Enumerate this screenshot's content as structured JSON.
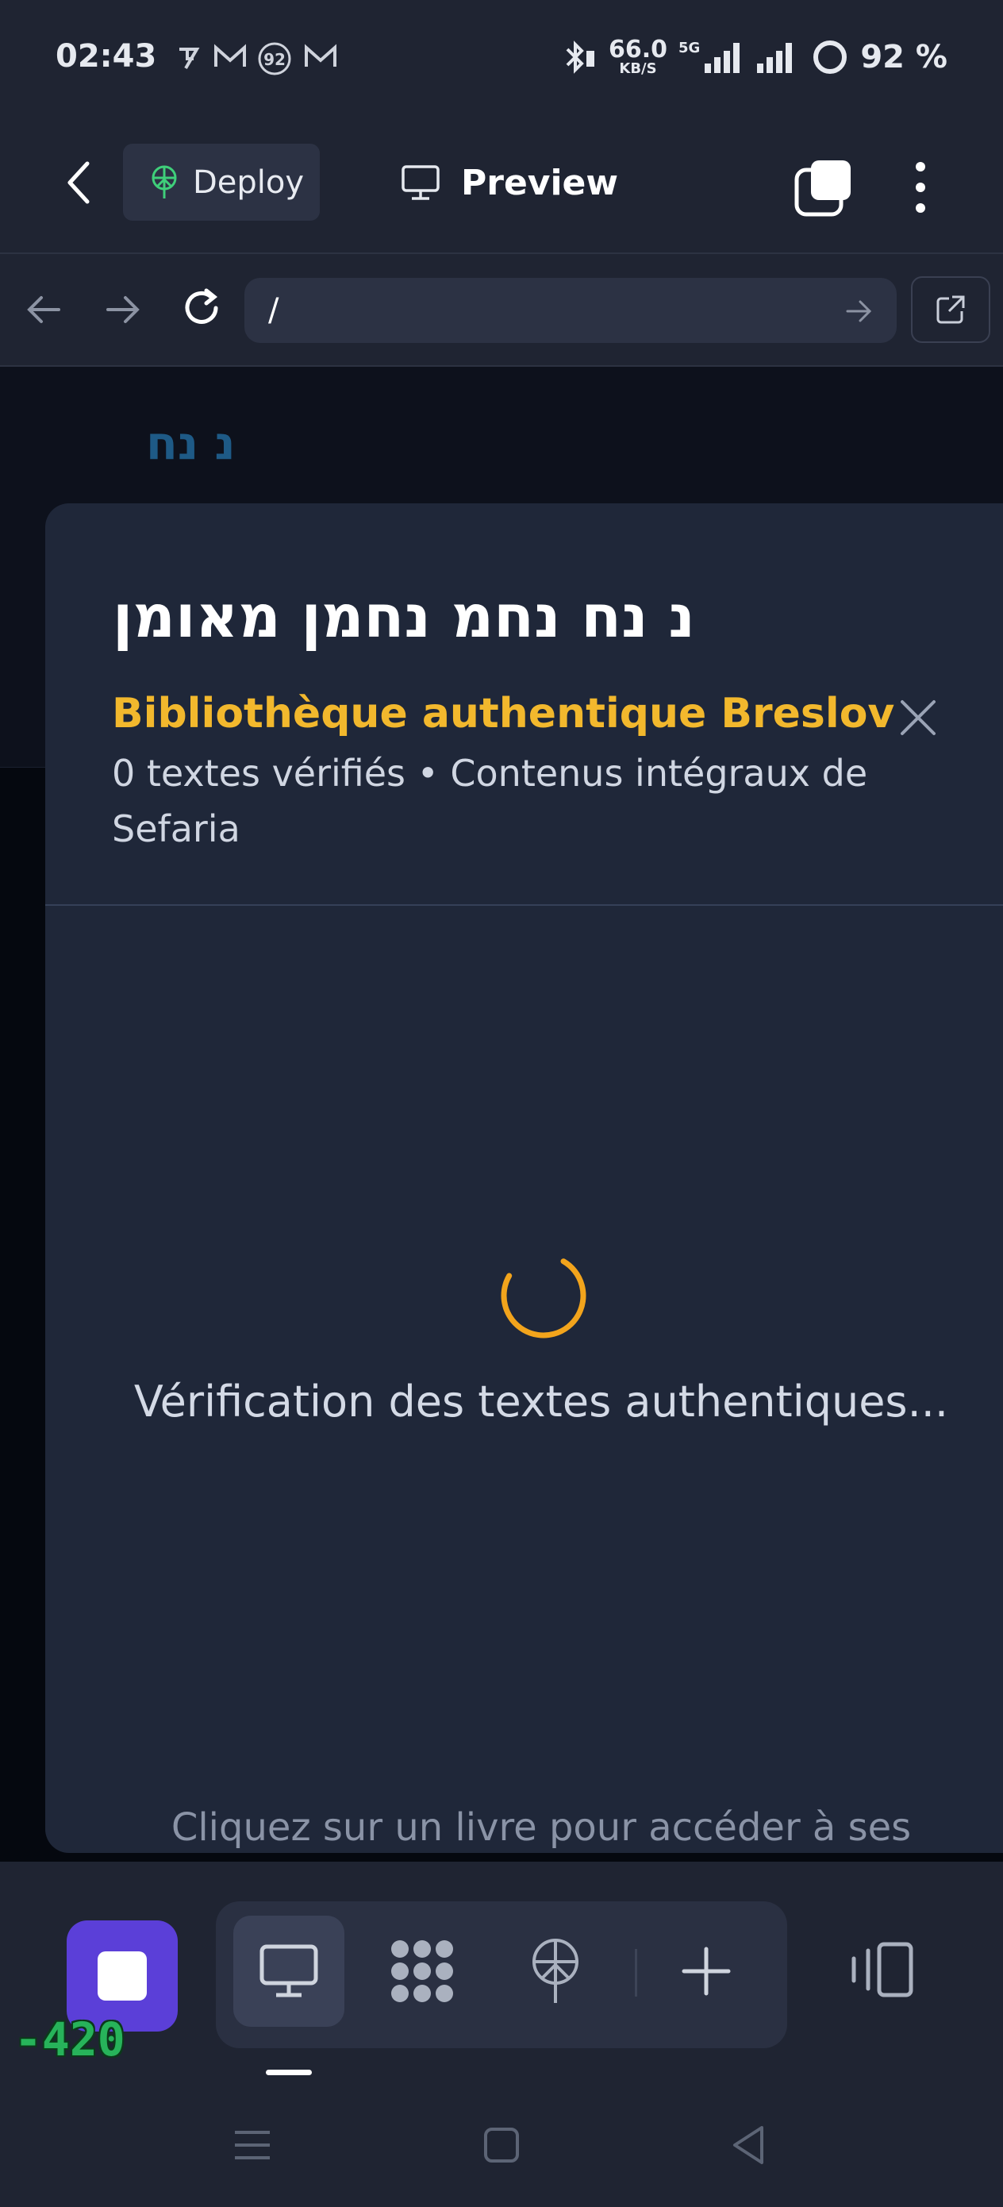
{
  "status_bar": {
    "time": "02:43",
    "network_speed": "66.0",
    "network_speed_unit": "KB/S",
    "network_type": "5G",
    "battery": "92 %"
  },
  "header": {
    "deploy_label": "Deploy",
    "preview_label": "Preview"
  },
  "browser": {
    "url": "/"
  },
  "page": {
    "logo": "נ נח",
    "modal": {
      "title": "נ נח נחמ נחמן מאומן",
      "subtitle": "Bibliothèque authentique Breslov",
      "stats": "0 textes vérifiés • Contenus intégraux de Sefaria",
      "loading_text": "Vérification des textes authentiques...",
      "hint_text": "Cliquez sur un livre pour accéder à ses"
    }
  },
  "toolbar": {
    "counter": "-420"
  },
  "colors": {
    "accent": "#f2b82d",
    "stop_button": "#5b3fd8",
    "background": "#1f2432",
    "modal_background": "#1f2739"
  }
}
